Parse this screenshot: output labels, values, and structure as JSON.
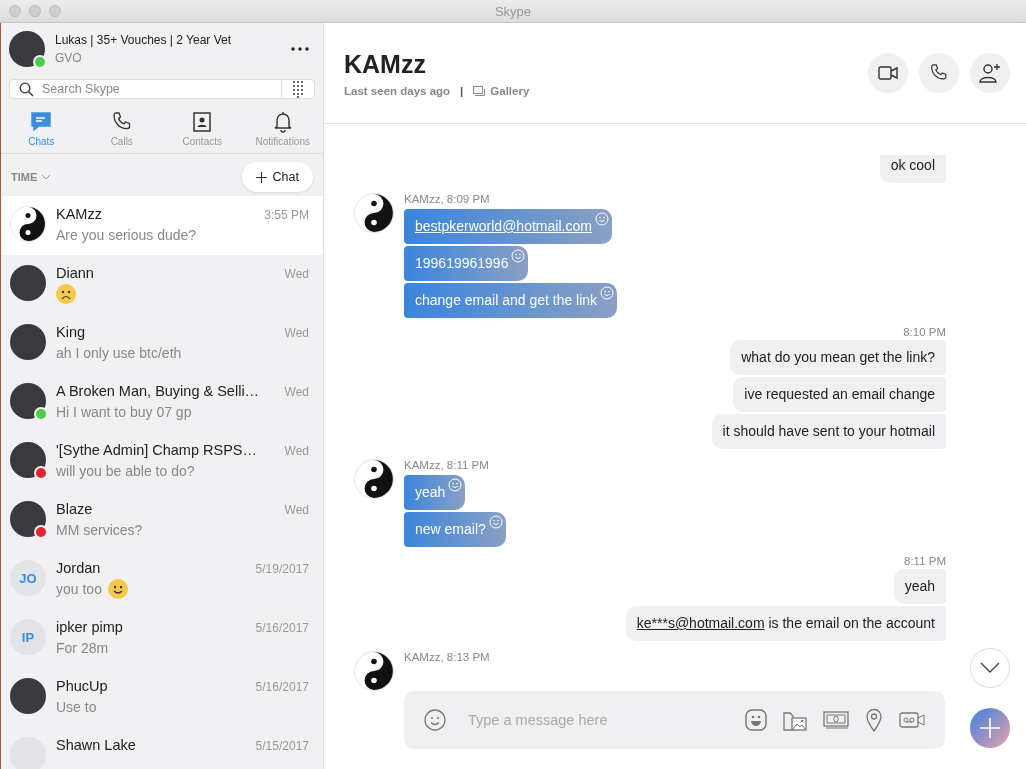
{
  "window": {
    "title": "Skype"
  },
  "profile": {
    "name": "Lukas | 35+ Vouches | 2 Year Vet",
    "mood": "GVO",
    "online": true
  },
  "search": {
    "placeholder": "Search Skype"
  },
  "tabs": [
    {
      "label": "Chats",
      "selected": true
    },
    {
      "label": "Calls",
      "selected": false
    },
    {
      "label": "Contacts",
      "selected": false
    },
    {
      "label": "Notifications",
      "selected": false
    }
  ],
  "sort": {
    "label": "TIME"
  },
  "new_chat": {
    "label": "Chat"
  },
  "conversations": [
    {
      "kind": "yinyang",
      "name": "KAMzz",
      "preview": [
        {
          "kind": "text",
          "text": "Are you serious dude?"
        }
      ],
      "time": "3:55 PM",
      "selected": true,
      "online": false,
      "busy": false
    },
    {
      "kind": "photo",
      "name": "Diann",
      "preview": [
        {
          "kind": "sad"
        }
      ],
      "time": "Wed",
      "selected": false,
      "online": false,
      "busy": false
    },
    {
      "kind": "photo",
      "name": "King",
      "preview": [
        {
          "kind": "text",
          "text": "ah I only use btc/eth"
        }
      ],
      "time": "Wed",
      "selected": false,
      "online": false,
      "busy": false
    },
    {
      "kind": "photo",
      "name": "A Broken Man, Buying & Selli…",
      "preview": [
        {
          "kind": "text",
          "text": "Hi I want to buy 07 gp"
        }
      ],
      "time": "Wed",
      "selected": false,
      "online": true,
      "busy": false
    },
    {
      "kind": "photo",
      "name": "'[Sythe Admin] Champ RSPS…",
      "preview": [
        {
          "kind": "text",
          "text": "will you be able to do?"
        }
      ],
      "time": "Wed",
      "selected": false,
      "online": false,
      "busy": true
    },
    {
      "kind": "photo",
      "name": "Blaze",
      "preview": [
        {
          "kind": "text",
          "text": "MM services?"
        }
      ],
      "time": "Wed",
      "selected": false,
      "online": false,
      "busy": true
    },
    {
      "kind": "initials",
      "initials": "JO",
      "name": "Jordan",
      "preview": [
        {
          "kind": "text",
          "text": "you too"
        },
        {
          "kind": "smile"
        }
      ],
      "time": "5/19/2017",
      "selected": false,
      "online": false,
      "busy": false
    },
    {
      "kind": "initials",
      "initials": "IP",
      "name": "ipker pimp",
      "preview": [
        {
          "kind": "text",
          "text": "For 28m"
        }
      ],
      "time": "5/16/2017",
      "selected": false,
      "online": false,
      "busy": false
    },
    {
      "kind": "photo",
      "name": "PhucUp",
      "preview": [
        {
          "kind": "text",
          "text": "Use to"
        }
      ],
      "time": "5/16/2017",
      "selected": false,
      "online": false,
      "busy": false
    },
    {
      "kind": "initials",
      "name": "Shawn Lake",
      "time": "5/15/2017",
      "selected": false,
      "online": false,
      "busy": false
    }
  ],
  "chat": {
    "title": "KAMzz",
    "last_seen": "Last seen days ago",
    "separator": "|",
    "gallery": "Gallery"
  },
  "messages": [
    {
      "kind": "outgoing",
      "bubbles": [
        [
          {
            "text": "ok cool"
          }
        ]
      ]
    },
    {
      "kind": "incoming",
      "sender": "KAMzz, 8:09 PM",
      "bubbles": [
        [
          {
            "link": "bestpkerworld@hotmail.com"
          }
        ],
        [
          {
            "text": "199619961996"
          }
        ],
        [
          {
            "text": "change email and get the link"
          }
        ]
      ]
    },
    {
      "kind": "outgoing",
      "time": "8:10 PM",
      "bubbles": [
        [
          {
            "text": "what do you mean get the link?"
          }
        ],
        [
          {
            "text": "ive requested an email change"
          }
        ],
        [
          {
            "text": "it should have sent to your hotmail"
          }
        ]
      ]
    },
    {
      "kind": "incoming",
      "sender": "KAMzz, 8:11 PM",
      "bubbles": [
        [
          {
            "text": "yeah"
          }
        ],
        [
          {
            "text": "new email?"
          }
        ]
      ]
    },
    {
      "kind": "outgoing",
      "time": "8:11 PM",
      "bubbles": [
        [
          {
            "text": "yeah"
          }
        ],
        [
          {
            "link": "ke***s@hotmail.com"
          },
          {
            "text": " is the email on the account"
          }
        ]
      ]
    },
    {
      "kind": "incoming",
      "sender": "KAMzz, 8:13 PM"
    }
  ],
  "composer": {
    "placeholder": "Type a message here"
  }
}
